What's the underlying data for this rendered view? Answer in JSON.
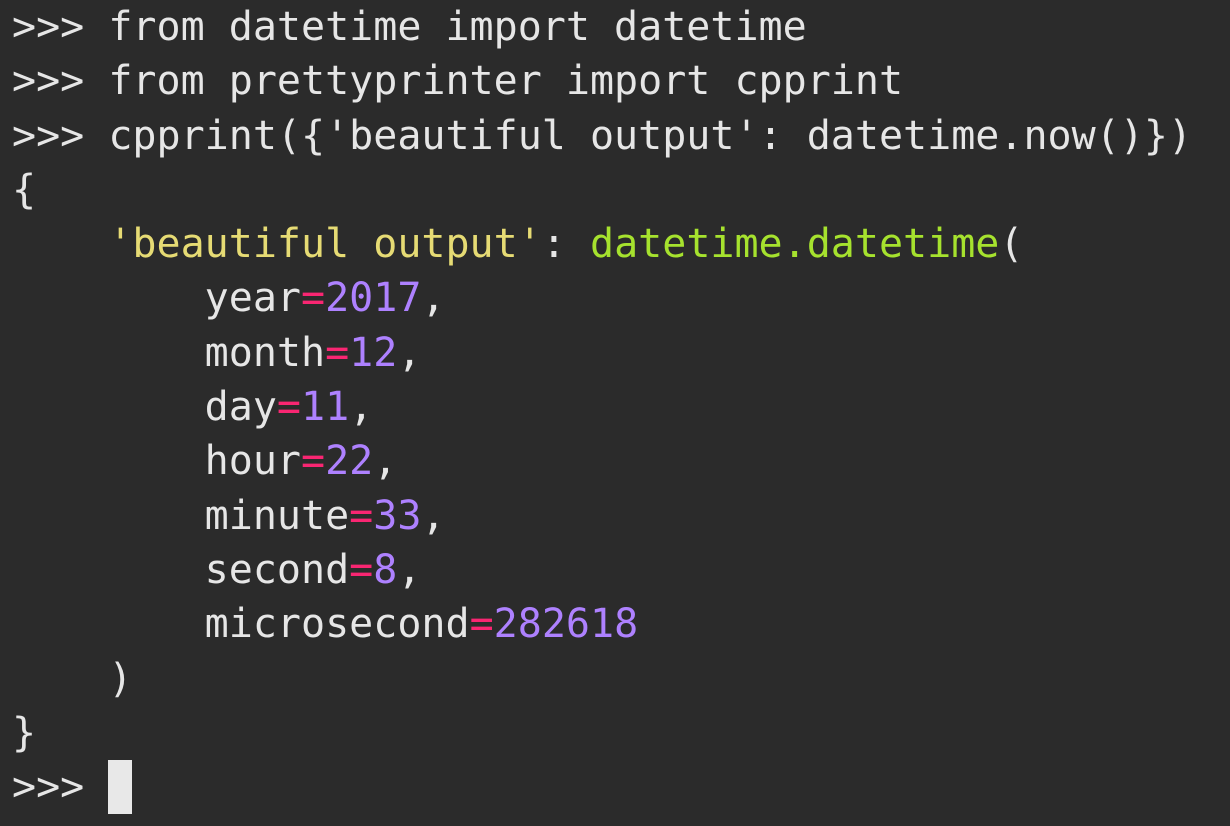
{
  "colors": {
    "background": "#2b2b2b",
    "text": "#e6e6e6",
    "string": "#e6db74",
    "function": "#a6e22e",
    "number": "#ae81ff",
    "operator": "#f92672",
    "cursor": "#e8e8e8"
  },
  "lines": {
    "l1": ">>> from datetime import datetime",
    "l2": ">>> from prettyprinter import cpprint",
    "l3": ">>> cpprint({'beautiful output': datetime.now()})",
    "l4": "{",
    "l5": {
      "indent": "    ",
      "key": "'beautiful output'",
      "colon": ": ",
      "call": "datetime.datetime",
      "open_paren": "("
    },
    "fields": [
      {
        "indent": "        ",
        "name": "year",
        "eq": "=",
        "value": "2017",
        "sep": ","
      },
      {
        "indent": "        ",
        "name": "month",
        "eq": "=",
        "value": "12",
        "sep": ","
      },
      {
        "indent": "        ",
        "name": "day",
        "eq": "=",
        "value": "11",
        "sep": ","
      },
      {
        "indent": "        ",
        "name": "hour",
        "eq": "=",
        "value": "22",
        "sep": ","
      },
      {
        "indent": "        ",
        "name": "minute",
        "eq": "=",
        "value": "33",
        "sep": ","
      },
      {
        "indent": "        ",
        "name": "second",
        "eq": "=",
        "value": "8",
        "sep": ","
      },
      {
        "indent": "        ",
        "name": "microsecond",
        "eq": "=",
        "value": "282618",
        "sep": ""
      }
    ],
    "close_paren": "    )",
    "close_brace": "}",
    "prompt": ">>> "
  }
}
